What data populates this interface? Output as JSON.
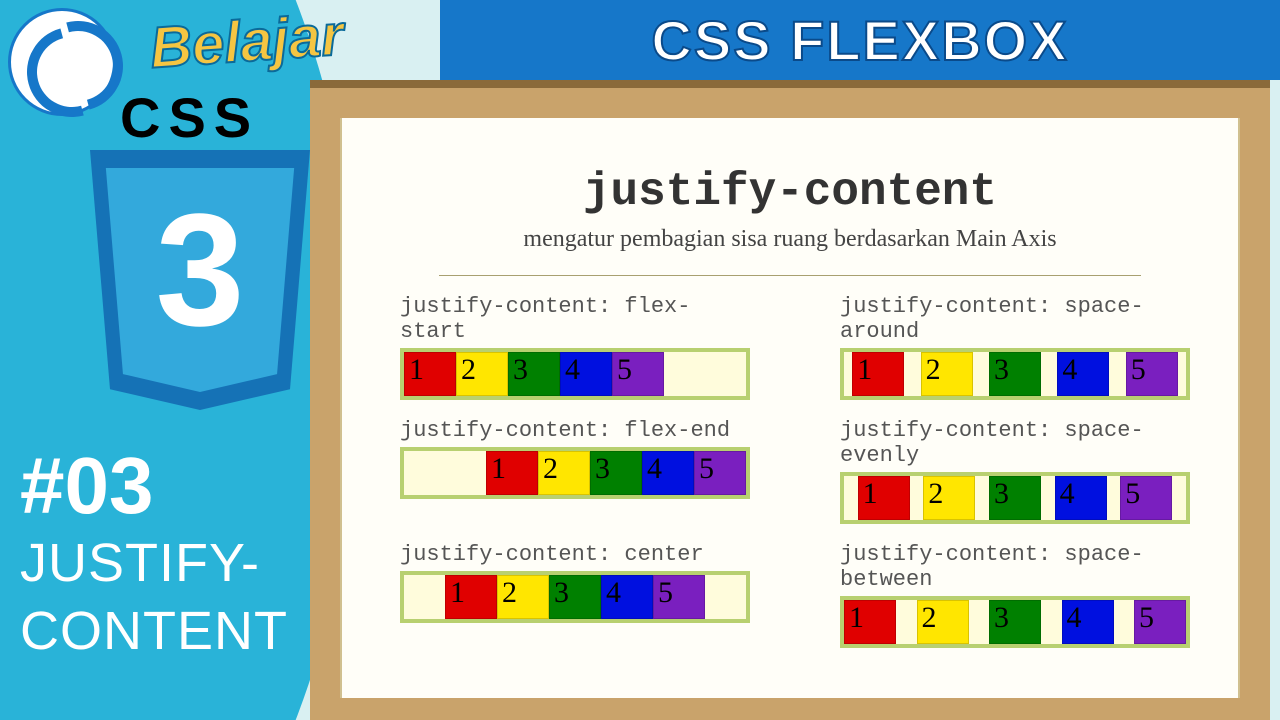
{
  "header": {
    "banner_title": "CSS FLEXBOX",
    "belajar_label": "Belajar"
  },
  "sidebar": {
    "css_label": "CSS",
    "shield_number": "3",
    "episode_number": "#03",
    "episode_title": "JUSTIFY-CONTENT"
  },
  "slide": {
    "title": "justify-content",
    "subtitle": "mengatur pembagian sisa ruang berdasarkan Main Axis",
    "items": [
      "1",
      "2",
      "3",
      "4",
      "5"
    ],
    "examples": [
      {
        "label": "justify-content: flex-start",
        "cls": "jstart"
      },
      {
        "label": "justify-content: space-around",
        "cls": "jaround"
      },
      {
        "label": "justify-content: flex-end",
        "cls": "jend"
      },
      {
        "label": "justify-content: space-evenly",
        "cls": "jevenly"
      },
      {
        "label": "justify-content: center",
        "cls": "jcenter"
      },
      {
        "label": "justify-content: space-between",
        "cls": "jbetween"
      }
    ]
  }
}
